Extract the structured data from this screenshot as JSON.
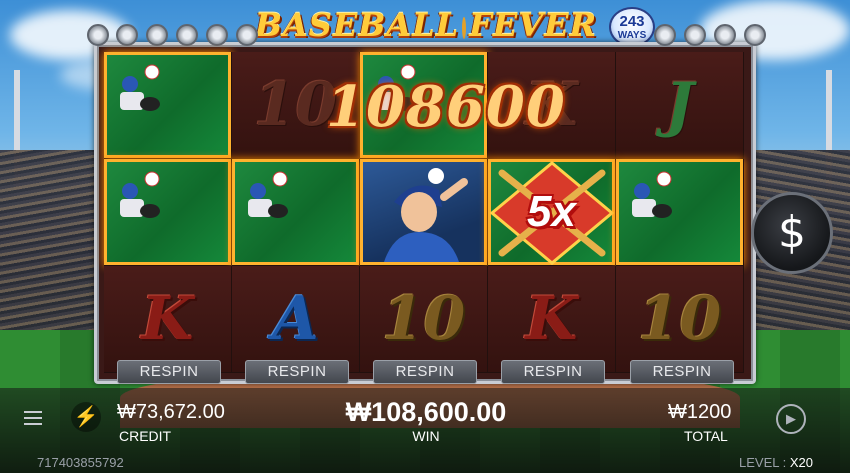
{
  "title": {
    "part1": "BASEBALL",
    "part2": "FEVER",
    "ways_number": "243",
    "ways_label": "WAYS"
  },
  "reels": {
    "win_amount_overlay": "108600",
    "multiplier": "5x",
    "symbols": [
      [
        "pitcher",
        "10",
        "pitcher",
        "K",
        "J"
      ],
      [
        "pitcher",
        "pitcher",
        "batter",
        "5x",
        "pitcher"
      ],
      [
        "K",
        "A",
        "10",
        "K",
        "10"
      ]
    ],
    "respin_label": "RESPIN"
  },
  "controls": {
    "dollar_label": "$",
    "credit_value": "₩73,672.00",
    "credit_label": "CREDIT",
    "win_value": "₩108,600.00",
    "win_label": "WIN",
    "total_value": "₩1200",
    "total_label": "TOTAL"
  },
  "footer": {
    "round_id": "717403855792",
    "level_label": "LEVEL :",
    "level_value": "X20"
  },
  "colors": {
    "win_highlight": "#ffb22e",
    "green_tile": "#1f8a3f",
    "reel_bg": "#4a1c19",
    "gold_text": "#ffcc3a"
  },
  "icons": [
    "menu-icon",
    "bolt-icon",
    "dollar-icon",
    "autoplay-icon",
    "baseball-icon"
  ]
}
